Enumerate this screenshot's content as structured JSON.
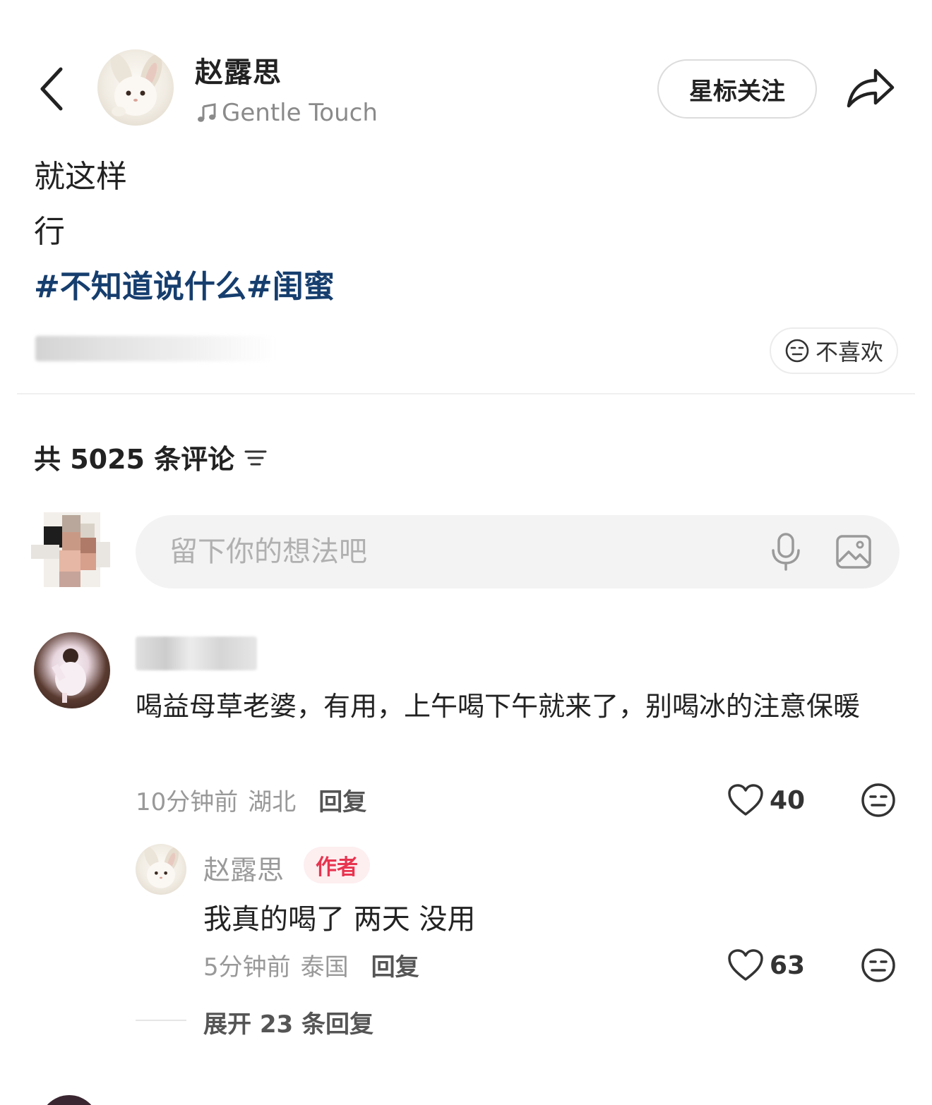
{
  "header": {
    "author_name": "赵露思",
    "music_title": "Gentle Touch",
    "follow_label": "星标关注"
  },
  "post": {
    "lines": [
      "就这样",
      "行"
    ],
    "hashtags": "#不知道说什么#闺蜜",
    "dislike_label": "不喜欢"
  },
  "comments_section": {
    "count_label": "共 5025 条评论",
    "input_placeholder": "留下你的想法吧",
    "comments": [
      {
        "text": "喝益母草老婆，有用，上午喝下午就来了，别喝冰的注意保暖",
        "time": "10分钟前",
        "location": "湖北",
        "reply_label": "回复",
        "likes": "40",
        "replies": [
          {
            "author": "赵露思",
            "badge": "作者",
            "text": "我真的喝了 两天 没用",
            "time": "5分钟前",
            "location": "泰国",
            "reply_label": "回复",
            "likes": "63"
          }
        ],
        "expand_label": "展开 23 条回复"
      }
    ]
  },
  "colors": {
    "hashtag": "#163e6e",
    "author_badge_text": "#e8344f",
    "author_badge_bg": "#fdeef0"
  }
}
